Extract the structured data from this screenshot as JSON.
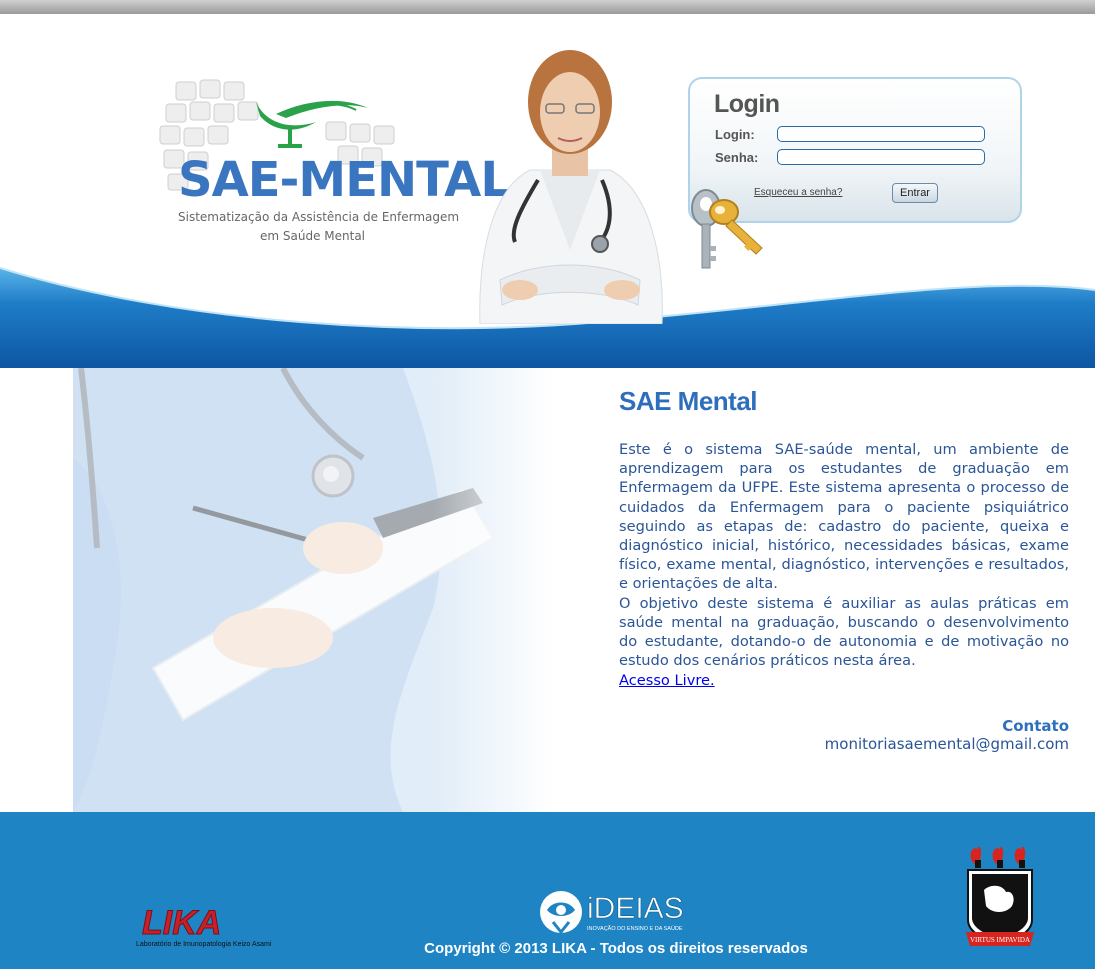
{
  "header": {
    "logo_title": "SAE-MENTAL",
    "logo_subtitle_line1": "Sistematização da Assistência de Enfermagem",
    "logo_subtitle_line2": "em Saúde Mental"
  },
  "login": {
    "title": "Login",
    "login_label": "Login:",
    "login_value": "",
    "password_label": "Senha:",
    "password_value": "",
    "forgot_link": "Esqueceu a senha?",
    "submit_label": "Entrar"
  },
  "main": {
    "heading": "SAE Mental",
    "paragraph1": "Este é o sistema SAE-saúde mental, um ambiente de aprendizagem para os estudantes de graduação em Enfermagem da UFPE. Este sistema apresenta o processo de cuidados da Enfermagem para o paciente psiquiátrico seguindo as etapas de: cadastro do paciente, queixa e diagnóstico inicial, histórico, necessidades básicas, exame físico, exame mental, diagnóstico, intervenções e resultados, e orientações de alta.",
    "paragraph2": "O objetivo deste sistema é auxiliar as aulas práticas em saúde mental na graduação, buscando o desenvolvimento do estudante, dotando-o de autonomia e de motivação no estudo dos cenários práticos nesta área.",
    "free_access_link": "Acesso Livre.",
    "contact_title": "Contato",
    "contact_email": "monitoriasaemental@gmail.com"
  },
  "footer": {
    "lika_logo_text": "LIKA",
    "lika_subtitle": "Laboratório de Imunopatologia Keizo Asami",
    "ideias_logo_text": "iDEIAS",
    "ideias_subtitle": "INOVAÇÃO DO ENSINO E DA SAÚDE",
    "copyright": "Copyright © 2013 LIKA - Todos os direitos reservados",
    "ufpe_motto": "VIRTUS IMPAVIDA"
  },
  "colors": {
    "brand_blue": "#3a75c0",
    "text_blue": "#2a5597",
    "footer_blue": "#1e84c3",
    "header_wave": "#1a6fbf"
  }
}
